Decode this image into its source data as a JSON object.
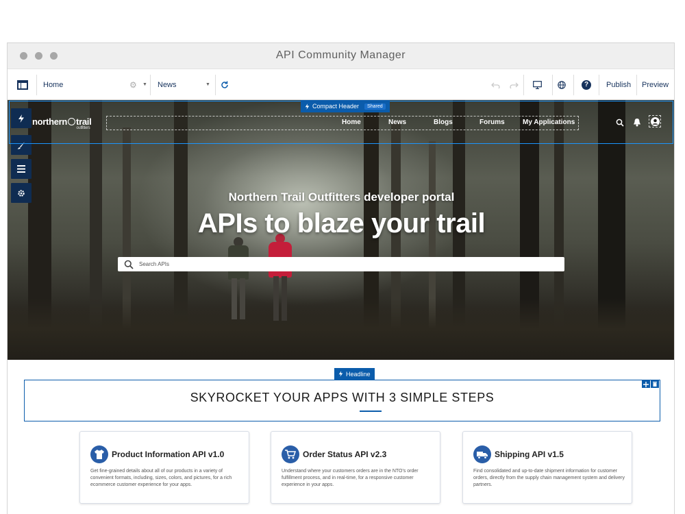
{
  "window": {
    "title": "API Community Manager"
  },
  "toolbar": {
    "page_select": "Home",
    "news_select": "News",
    "publish_label": "Publish",
    "preview_label": "Preview"
  },
  "builder": {
    "header_component_label": "Compact Header",
    "header_shared_badge": "Shared",
    "headline_component_label": "Headline"
  },
  "site_header": {
    "logo_text": "northern",
    "logo_text_2": "trail",
    "logo_sub": "outfitters",
    "nav": [
      "Home",
      "News",
      "Blogs",
      "Forums",
      "My Applications"
    ]
  },
  "hero": {
    "subtitle": "Northern Trail Outfitters developer portal",
    "title": "APIs to blaze your trail",
    "search_placeholder": "Search APIs"
  },
  "section": {
    "headline": "SKYROCKET YOUR APPS WITH 3 SIMPLE STEPS"
  },
  "cards": [
    {
      "icon": "shirt-icon",
      "title": "Product Information API v1.0",
      "description": "Get fine-grained details about all of our products in a variety of convenient formats, including, sizes, colors, and pictures, for a rich ecommerce customer experience for your apps."
    },
    {
      "icon": "cart-icon",
      "title": "Order Status API v2.3",
      "description": "Understand where your customers orders are in the NTO's order fulfillment process, and in real-time, for a responsive customer experience in your apps."
    },
    {
      "icon": "truck-icon",
      "title": "Shipping API v1.5",
      "description": "Find consolidated and up-to-date shipment information for customer orders, directly from the supply chain management system and delivery partners."
    }
  ],
  "colors": {
    "accent": "#0b5cab",
    "selection": "#1b96ff",
    "sidebar": "#0f2c52"
  }
}
